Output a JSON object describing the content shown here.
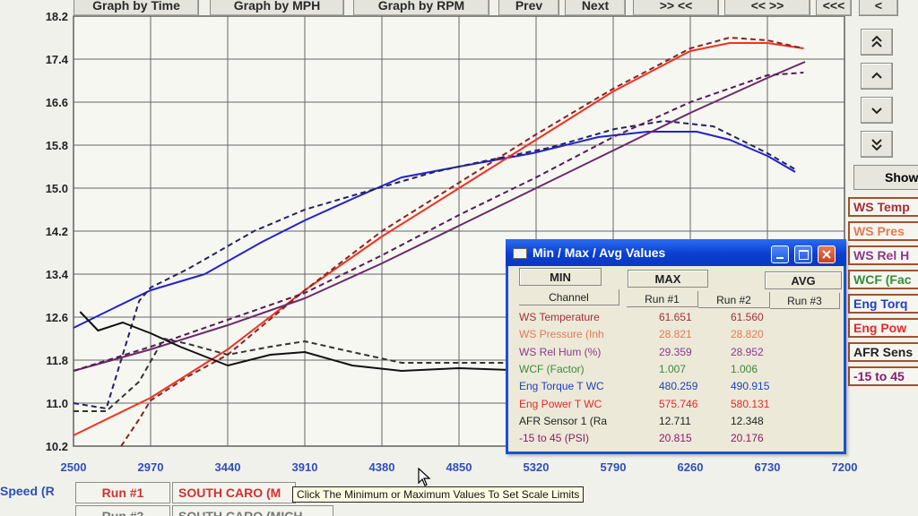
{
  "toolbar": {
    "graph_by_time": "Graph by Time",
    "graph_by_mph": "Graph by MPH",
    "graph_by_rpm": "Graph by RPM",
    "prev": "Prev",
    "next": "Next",
    "step_a": ">> <<",
    "step_b": "<< >>",
    "step_c": "<<<",
    "step_d": "<"
  },
  "side_panel": {
    "show_label": "Show",
    "channels": [
      {
        "label": "WS Temp",
        "color": "#a0303a"
      },
      {
        "label": "WS Pres",
        "color": "#e07a55"
      },
      {
        "label": "WS Rel H",
        "color": "#8a3a8a"
      },
      {
        "label": "WCF (Fac",
        "color": "#3a8a3a"
      },
      {
        "label": "Eng Torq",
        "color": "#2040c0"
      },
      {
        "label": "Eng Pow",
        "color": "#e02a2a"
      },
      {
        "label": "AFR Sens",
        "color": "#222222"
      },
      {
        "label": "-15 to 45",
        "color": "#8a1c6a"
      }
    ]
  },
  "chart_data": {
    "type": "line",
    "xlim": [
      2500,
      7200
    ],
    "ylim": [
      10.2,
      18.2
    ],
    "x_ticks": [
      "2500",
      "2970",
      "3440",
      "3910",
      "4380",
      "4850",
      "5320",
      "5790",
      "6260",
      "6730",
      "7200"
    ],
    "y_ticks": [
      "18.2",
      "17.4",
      "16.6",
      "15.8",
      "15.0",
      "14.2",
      "13.4",
      "12.6",
      "11.8",
      "11.0",
      "10.2"
    ],
    "grid": true,
    "series": [
      {
        "color": "#2222cc",
        "style": "solid",
        "x": [
          2500,
          2700,
          2970,
          3300,
          3650,
          3910,
          4200,
          4500,
          4850,
          5300,
          5700,
          6000,
          6300,
          6500,
          6730,
          6900
        ],
        "y": [
          12.4,
          12.7,
          13.1,
          13.4,
          14.0,
          14.4,
          14.8,
          15.2,
          15.4,
          15.65,
          15.95,
          16.05,
          16.05,
          15.9,
          15.6,
          15.3
        ]
      },
      {
        "color": "#222266",
        "style": "dashed",
        "x": [
          2500,
          2700,
          2800,
          2900,
          2970,
          3200,
          3600,
          3910,
          4300,
          4700,
          5000,
          5400,
          5800,
          6100,
          6400,
          6730,
          6900
        ],
        "y": [
          11.0,
          10.9,
          11.9,
          12.9,
          13.15,
          13.5,
          14.2,
          14.6,
          14.95,
          15.3,
          15.5,
          15.75,
          16.1,
          16.25,
          16.15,
          15.65,
          15.35
        ]
      },
      {
        "color": "#ee3322",
        "style": "solid",
        "x": [
          2500,
          2970,
          3440,
          3910,
          4380,
          4850,
          5320,
          5790,
          6260,
          6500,
          6730,
          6950
        ],
        "y": [
          10.4,
          11.1,
          12.0,
          13.1,
          14.1,
          15.0,
          15.9,
          16.8,
          17.55,
          17.7,
          17.7,
          17.6
        ]
      },
      {
        "color": "#882222",
        "style": "dashed",
        "x": [
          2790,
          2900,
          2970,
          3200,
          3440,
          3910,
          4380,
          4850,
          5320,
          5790,
          6260,
          6500,
          6730,
          6950
        ],
        "y": [
          10.2,
          10.7,
          11.05,
          11.5,
          11.9,
          13.1,
          14.2,
          15.1,
          16.0,
          16.85,
          17.6,
          17.8,
          17.75,
          17.6
        ]
      },
      {
        "color": "#6a2a6a",
        "style": "solid",
        "x": [
          2500,
          2970,
          3440,
          3910,
          4380,
          4850,
          5320,
          5790,
          6260,
          6730,
          6960
        ],
        "y": [
          11.6,
          12.0,
          12.45,
          12.95,
          13.6,
          14.3,
          15.0,
          15.7,
          16.4,
          17.05,
          17.35
        ]
      },
      {
        "color": "#551a55",
        "style": "dashed",
        "x": [
          2500,
          2970,
          3440,
          3910,
          4380,
          4850,
          5320,
          5790,
          6260,
          6730,
          6950
        ],
        "y": [
          11.6,
          12.05,
          12.55,
          13.05,
          13.75,
          14.5,
          15.2,
          15.95,
          16.6,
          17.1,
          17.15
        ]
      },
      {
        "color": "#111111",
        "style": "solid",
        "x": [
          2540,
          2650,
          2800,
          2970,
          3150,
          3440,
          3700,
          3910,
          4200,
          4500,
          4850,
          5320,
          5600
        ],
        "y": [
          12.7,
          12.35,
          12.5,
          12.3,
          12.05,
          11.7,
          11.9,
          11.95,
          11.7,
          11.6,
          11.65,
          11.6,
          11.6
        ]
      },
      {
        "color": "#333333",
        "style": "dashed",
        "x": [
          2500,
          2700,
          2900,
          3050,
          3200,
          3440,
          3700,
          3910,
          4200,
          4500,
          4850,
          5320,
          5600
        ],
        "y": [
          10.85,
          10.85,
          11.4,
          12.2,
          12.1,
          11.9,
          12.05,
          12.15,
          11.95,
          11.75,
          11.75,
          11.75,
          11.7
        ]
      }
    ]
  },
  "dialog": {
    "title": "Min / Max / Avg Values",
    "btn_min": "MIN",
    "btn_max": "MAX",
    "btn_avg": "AVG",
    "col_channel": "Channel",
    "col_run1": "Run #1",
    "col_run2": "Run #2",
    "col_run3": "Run #3",
    "rows": [
      {
        "channel": "WS Temperature",
        "run1": "61.651",
        "run2": "61.560",
        "color": "#a0303a"
      },
      {
        "channel": "WS Pressure (Inh",
        "run1": "28.821",
        "run2": "28.820",
        "color": "#e07a55"
      },
      {
        "channel": "WS Rel Hum (%)",
        "run1": "29.359",
        "run2": "28.952",
        "color": "#8a3a8a"
      },
      {
        "channel": "WCF (Factor)",
        "run1": "1.007",
        "run2": "1.006",
        "color": "#3a8a3a"
      },
      {
        "channel": "Eng Torque T WC",
        "run1": "480.259",
        "run2": "490.915",
        "color": "#2040c0"
      },
      {
        "channel": "Eng Power T WC",
        "run1": "575.746",
        "run2": "580.131",
        "color": "#e02a2a"
      },
      {
        "channel": "AFR Sensor 1 (Ra",
        "run1": "12.711",
        "run2": "12.348",
        "color": "#222222"
      },
      {
        "channel": "-15 to 45 (PSI)",
        "run1": "20.815",
        "run2": "20.176",
        "color": "#8a1c6a"
      }
    ]
  },
  "bottom": {
    "speed_label": "Speed (R",
    "run1_label": "Run #1",
    "run1_name": "SOUTH CARO (M",
    "run2_label": "Run #2",
    "run2_name": "SOUTH CARO (MICH",
    "tooltip": "Click The Minimum or Maximum Values To Set Scale Limits"
  }
}
